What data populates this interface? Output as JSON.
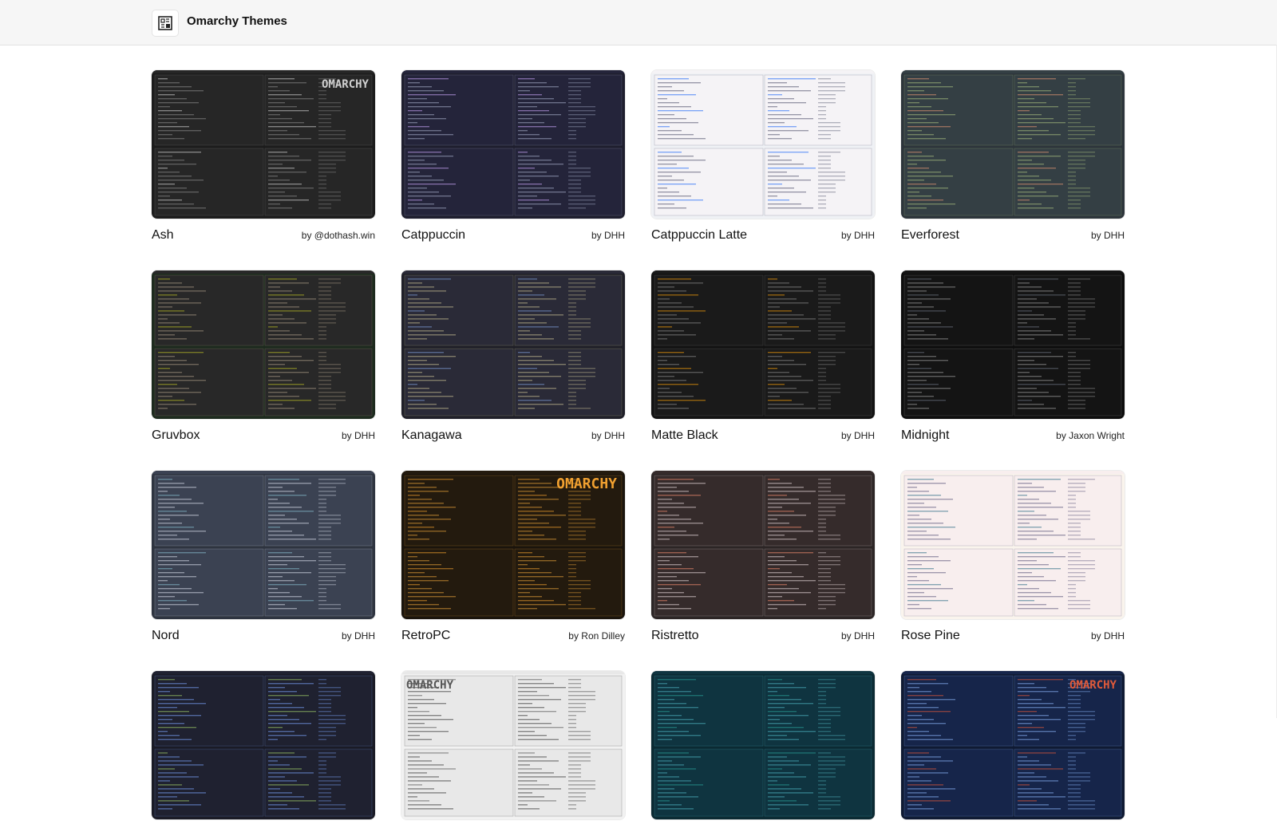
{
  "app": {
    "title": "Omarchy Themes",
    "logo_icon": "omarchy-logo-icon"
  },
  "themes": [
    {
      "name": "Ash",
      "author": "by @dothash.win",
      "bg": "#1c1c1c",
      "pane": "#262626",
      "line": "#8a8a8a",
      "accent": "#d0d0d0",
      "logo": "OMARCHY"
    },
    {
      "name": "Catppuccin",
      "author": "by DHH",
      "bg": "#1e1e2e",
      "pane": "#24243a",
      "line": "#a6adc8",
      "accent": "#cba6f7",
      "logo": ""
    },
    {
      "name": "Catppuccin Latte",
      "author": "by DHH",
      "bg": "#eff1f5",
      "pane": "#f5f3f6",
      "line": "#4c4f69",
      "accent": "#1e66f5",
      "logo": ""
    },
    {
      "name": "Everforest",
      "author": "by DHH",
      "bg": "#2d353b",
      "pane": "#343f44",
      "line": "#a7c080",
      "accent": "#e69875",
      "logo": ""
    },
    {
      "name": "Gruvbox",
      "author": "by DHH",
      "bg": "#1d2a1e",
      "pane": "#282828",
      "line": "#a89984",
      "accent": "#b8bb26",
      "logo": ""
    },
    {
      "name": "Kanagawa",
      "author": "by DHH",
      "bg": "#1f1f28",
      "pane": "#2a2a37",
      "line": "#c8c093",
      "accent": "#7e9cd8",
      "logo": ""
    },
    {
      "name": "Matte Black",
      "author": "by DHH",
      "bg": "#121212",
      "pane": "#1a1a1a",
      "line": "#8a8a8a",
      "accent": "#f59e0b",
      "logo": ""
    },
    {
      "name": "Midnight",
      "author": "by Jaxon Wright",
      "bg": "#0d0d0d",
      "pane": "#141414",
      "line": "#9a9a9a",
      "accent": "#6b7280",
      "logo": ""
    },
    {
      "name": "Nord",
      "author": "by DHH",
      "bg": "#2e3440",
      "pane": "#3b4252",
      "line": "#d8dee9",
      "accent": "#88c0d0",
      "logo": ""
    },
    {
      "name": "RetroPC",
      "author": "by Ron Dilley",
      "bg": "#1a140c",
      "pane": "#231a0e",
      "line": "#e8a33a",
      "accent": "#f0a030",
      "logo": "OMARCHY"
    },
    {
      "name": "Ristretto",
      "author": "by DHH",
      "bg": "#2c2525",
      "pane": "#352b2b",
      "line": "#e6d9db",
      "accent": "#f38d70",
      "logo": ""
    },
    {
      "name": "Rose Pine",
      "author": "by DHH",
      "bg": "#faf4ed",
      "pane": "#f8eeee",
      "line": "#575279",
      "accent": "#286983",
      "logo": ""
    },
    {
      "name": "",
      "author": "",
      "bg": "#1a1b26",
      "pane": "#1f2130",
      "line": "#7aa2f7",
      "accent": "#9ece6a",
      "logo": ""
    },
    {
      "name": "",
      "author": "",
      "bg": "#f2f2f2",
      "pane": "#e8e8e8",
      "line": "#333333",
      "accent": "#555555",
      "logo": "OMARCHY"
    },
    {
      "name": "",
      "author": "",
      "bg": "#0b2a33",
      "pane": "#0f3440",
      "line": "#4fb3bf",
      "accent": "#2aa198",
      "logo": ""
    },
    {
      "name": "",
      "author": "",
      "bg": "#0f1a33",
      "pane": "#16254a",
      "line": "#8ab4f8",
      "accent": "#e05a3a",
      "logo": "OMARCHY"
    }
  ]
}
